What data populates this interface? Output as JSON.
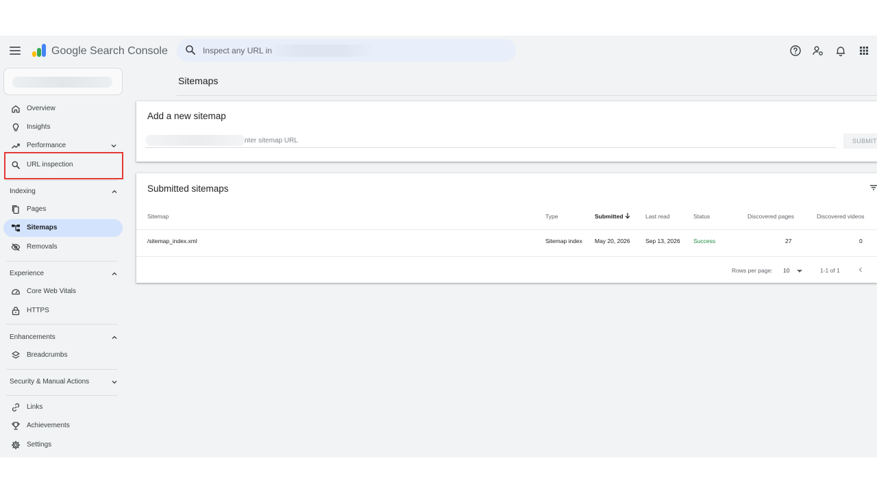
{
  "header": {
    "app_name": "Google Search Console",
    "search_placeholder": "Inspect any URL in",
    "icons": [
      "menu-icon",
      "search-icon",
      "help-icon",
      "manage-users-icon",
      "notifications-icon",
      "apps-grid-icon"
    ]
  },
  "sidebar": {
    "top_items": [
      {
        "label": "Overview",
        "icon": "home-icon"
      },
      {
        "label": "Insights",
        "icon": "lightbulb-icon"
      },
      {
        "label": "Performance",
        "icon": "trending-up-icon"
      },
      {
        "label": "URL inspection",
        "icon": "search-icon"
      }
    ],
    "indexing": {
      "title": "Indexing",
      "items": [
        {
          "label": "Pages",
          "icon": "pages-icon"
        },
        {
          "label": "Sitemaps",
          "icon": "sitemap-icon",
          "active": true
        },
        {
          "label": "Removals",
          "icon": "eye-off-icon"
        }
      ]
    },
    "experience": {
      "title": "Experience",
      "items": [
        {
          "label": "Core Web Vitals",
          "icon": "gauge-icon"
        },
        {
          "label": "HTTPS",
          "icon": "lock-icon"
        }
      ]
    },
    "enhancements": {
      "title": "Enhancements",
      "items": [
        {
          "label": "Breadcrumbs",
          "icon": "breadcrumbs-icon"
        }
      ]
    },
    "security": {
      "title": "Security & Manual Actions"
    },
    "bottom_items": [
      {
        "label": "Links",
        "icon": "link-icon"
      },
      {
        "label": "Achievements",
        "icon": "trophy-icon"
      },
      {
        "label": "Settings",
        "icon": "settings-icon"
      }
    ]
  },
  "main": {
    "page_title": "Sitemaps",
    "add_card": {
      "title": "Add a new sitemap",
      "input_placeholder": "nter sitemap URL",
      "submit_label": "SUBMIT"
    },
    "submitted_card": {
      "title": "Submitted sitemaps",
      "columns": [
        "Sitemap",
        "Type",
        "Submitted",
        "Last read",
        "Status",
        "Discovered pages",
        "Discovered videos"
      ],
      "rows": [
        {
          "sitemap": "/sitemap_index.xml",
          "type": "Sitemap index",
          "submitted": "May 20, 2026",
          "last_read": "Sep 13, 2026",
          "status": "Success",
          "discovered_pages": "27",
          "discovered_videos": "0"
        }
      ],
      "pagination": {
        "rows_per_page_label": "Rows per page:",
        "rows_per_page": "10",
        "range": "1-1 of 1"
      }
    }
  },
  "colors": {
    "accent_active": "#d3e3fd",
    "success": "#1e8e3e",
    "highlight_box": "#e53935",
    "search_bg": "#e8eefa"
  }
}
